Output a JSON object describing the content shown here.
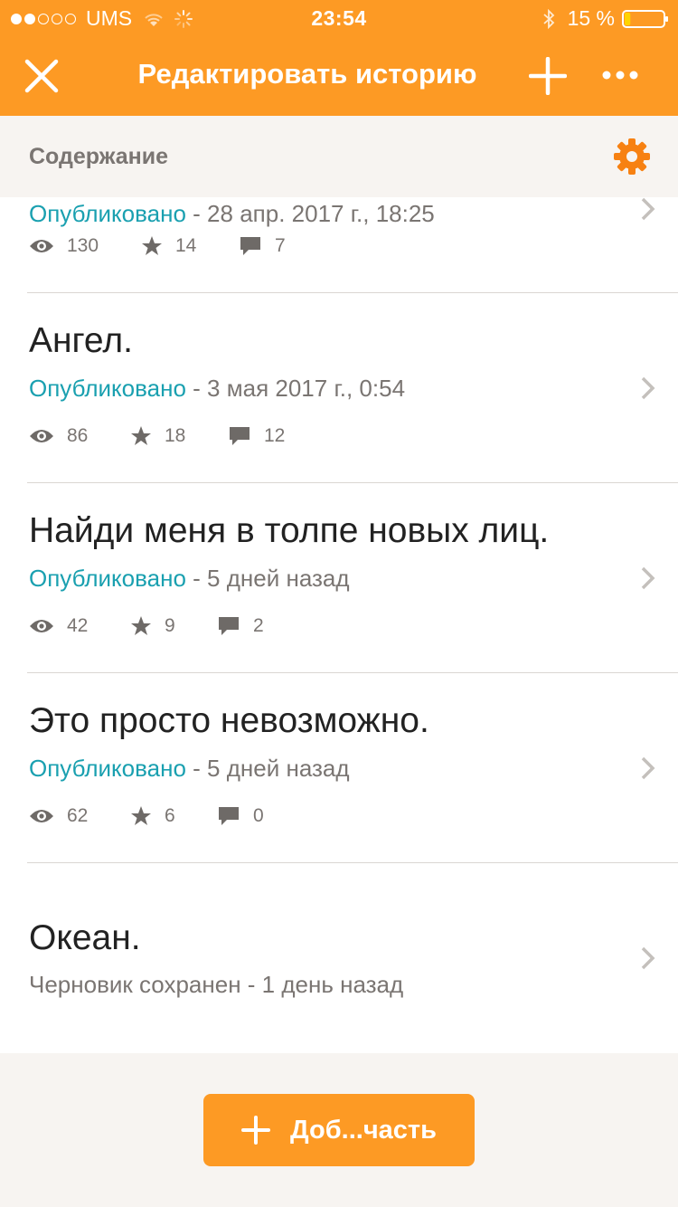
{
  "status_bar": {
    "carrier": "UMS",
    "time": "23:54",
    "battery": "15 %",
    "battery_level_fraction": 0.15,
    "signal_bars_filled": 2,
    "signal_bars_total": 5
  },
  "nav": {
    "title": "Редактировать историю",
    "close_icon": "close-icon",
    "add_icon": "plus-icon",
    "more_icon": "more-icon"
  },
  "section": {
    "label": "Содержание",
    "settings_icon": "gear-icon"
  },
  "parts": [
    {
      "title": "",
      "status": "Опубликовано",
      "date": " - 28 апр. 2017 г., 18:25",
      "views": "130",
      "stars": "14",
      "comments": "7"
    },
    {
      "title": "Ангел.",
      "status": "Опубликовано",
      "date": " - 3 мая 2017 г., 0:54",
      "views": "86",
      "stars": "18",
      "comments": "12"
    },
    {
      "title": "Найди меня в толпе новых лиц.",
      "status": "Опубликовано",
      "date": " - 5 дней назад",
      "views": "42",
      "stars": "9",
      "comments": "2"
    },
    {
      "title": "Это просто невозможно.",
      "status": "Опубликовано",
      "date": " - 5 дней назад",
      "views": "62",
      "stars": "6",
      "comments": "0"
    },
    {
      "title": "Океан.",
      "status_draft": "Черновик сохранен - 1 день назад"
    }
  ],
  "footer": {
    "add_part_label": "Доб...часть"
  },
  "colors": {
    "accent": "#fd9a24",
    "published": "#1aa0b0",
    "muted": "#7a7572",
    "title": "#222222"
  }
}
